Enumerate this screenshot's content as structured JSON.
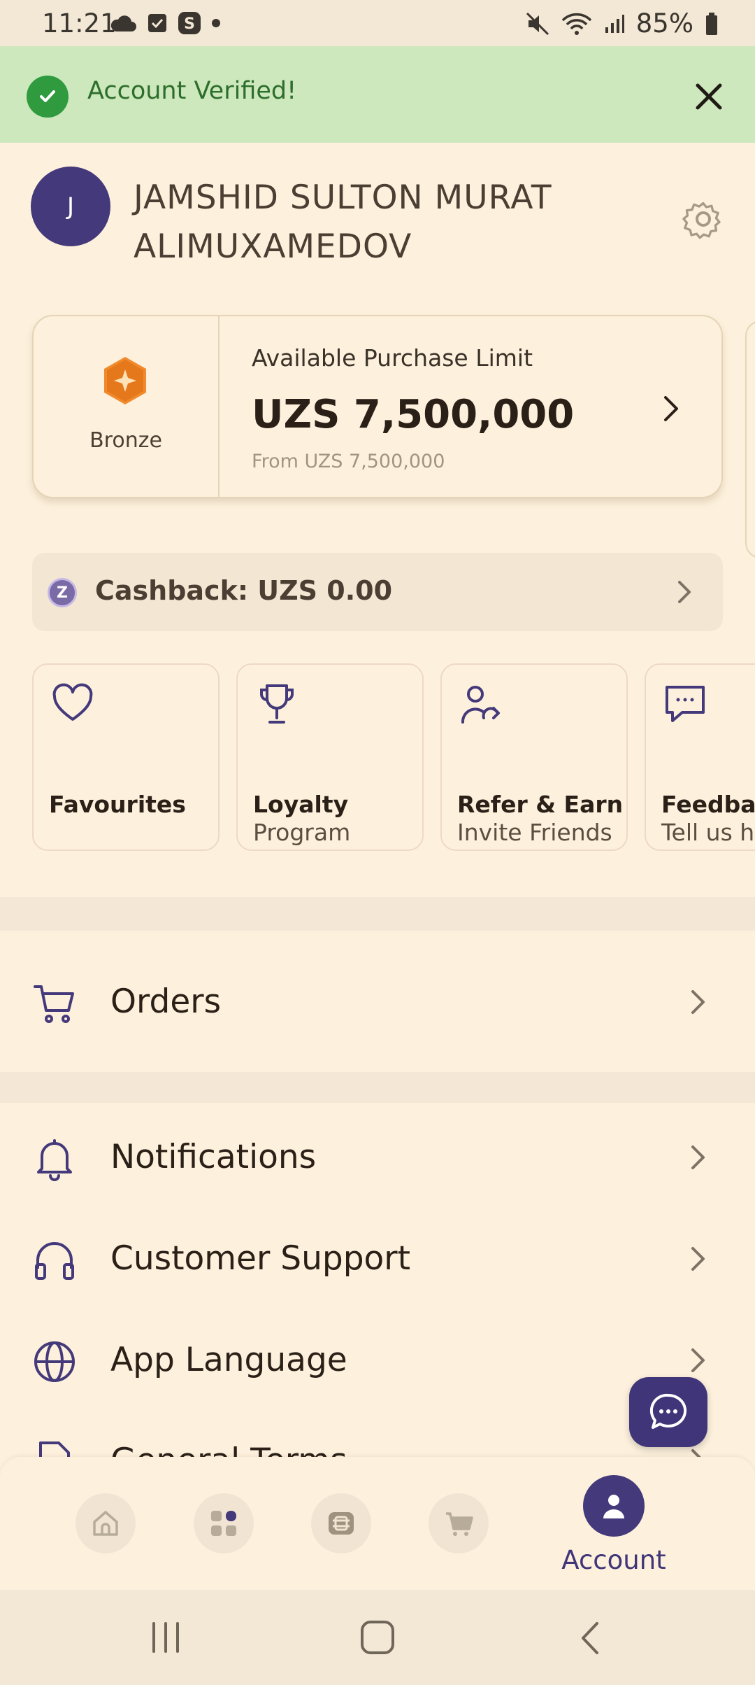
{
  "status_bar": {
    "time": "11:21",
    "battery": "85%"
  },
  "banner": {
    "message": "Account Verified!"
  },
  "profile": {
    "avatar_initial": "J",
    "name": "JAMSHID SULTON MURAT ALIMUXAMEDOV"
  },
  "purchase_card": {
    "tier": "Bronze",
    "label": "Available Purchase Limit",
    "amount": "UZS 7,500,000",
    "from": "From UZS 7,500,000"
  },
  "cashback": {
    "label": "Cashback: UZS 0.00",
    "badge": "Z"
  },
  "tiles": [
    {
      "title": "Favourites",
      "subtitle": "",
      "icon": "heart-icon"
    },
    {
      "title": "Loyalty",
      "subtitle": "Program",
      "icon": "trophy-icon"
    },
    {
      "title": "Refer & Earn",
      "subtitle": "Invite Friends",
      "icon": "refer-user-icon"
    },
    {
      "title": "Feedbac",
      "subtitle": "Tell us ho",
      "icon": "chat-dots-icon"
    }
  ],
  "menu": {
    "orders": "Orders",
    "notifications": "Notifications",
    "support": "Customer Support",
    "language": "App Language",
    "terms": "General Terms"
  },
  "bottom_nav": {
    "account_label": "Account",
    "active": "account"
  },
  "colors": {
    "accent": "#44397a",
    "banner_bg": "#cde8bd",
    "background": "#fdf1dd",
    "tier_orange": "#f08a2c"
  }
}
